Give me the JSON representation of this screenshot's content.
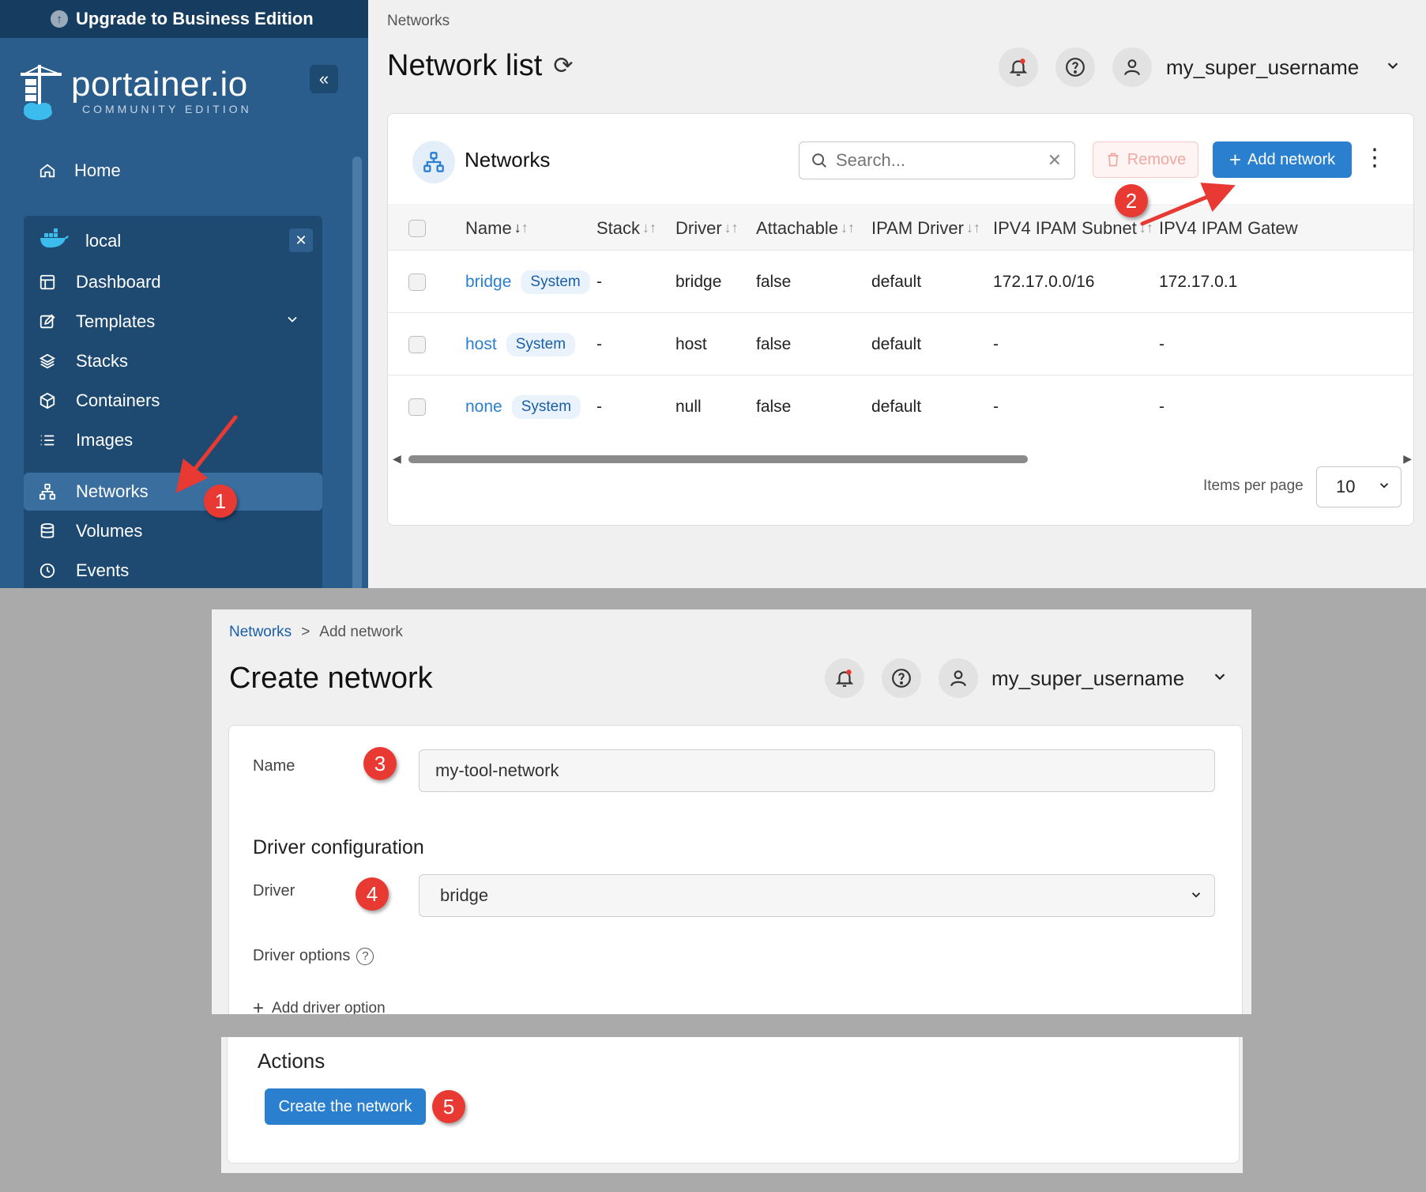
{
  "sidebar": {
    "upgrade_label": "Upgrade to Business Edition",
    "logo_text": "portainer.io",
    "logo_subtitle": "COMMUNITY EDITION",
    "home_label": "Home",
    "environment": {
      "name": "local",
      "items": [
        {
          "label": "Dashboard",
          "icon": "dashboard-icon"
        },
        {
          "label": "Templates",
          "icon": "templates-icon"
        },
        {
          "label": "Stacks",
          "icon": "stacks-icon"
        },
        {
          "label": "Containers",
          "icon": "containers-icon"
        },
        {
          "label": "Images",
          "icon": "images-icon"
        },
        {
          "label": "Networks",
          "icon": "networks-icon",
          "active": true
        },
        {
          "label": "Volumes",
          "icon": "volumes-icon"
        },
        {
          "label": "Events",
          "icon": "events-icon"
        }
      ]
    }
  },
  "network_list": {
    "breadcrumb": "Networks",
    "title": "Network list",
    "user_name": "my_super_username",
    "card_title": "Networks",
    "search_placeholder": "Search...",
    "remove_label": "Remove",
    "add_label": "Add network",
    "columns": [
      "Name",
      "Stack",
      "Driver",
      "Attachable",
      "IPAM Driver",
      "IPV4 IPAM Subnet",
      "IPV4 IPAM Gatew"
    ],
    "rows": [
      {
        "name": "bridge",
        "badge": "System",
        "stack": "-",
        "driver": "bridge",
        "attachable": "false",
        "ipam_driver": "default",
        "subnet": "172.17.0.0/16",
        "gateway": "172.17.0.1"
      },
      {
        "name": "host",
        "badge": "System",
        "stack": "-",
        "driver": "host",
        "attachable": "false",
        "ipam_driver": "default",
        "subnet": "-",
        "gateway": "-"
      },
      {
        "name": "none",
        "badge": "System",
        "stack": "-",
        "driver": "null",
        "attachable": "false",
        "ipam_driver": "default",
        "subnet": "-",
        "gateway": "-"
      }
    ],
    "items_per_page_label": "Items per page",
    "items_per_page_value": "10"
  },
  "create_network": {
    "breadcrumb_link": "Networks",
    "breadcrumb_sep": ">",
    "breadcrumb_current": "Add network",
    "title": "Create network",
    "user_name": "my_super_username",
    "name_label": "Name",
    "name_value": "my-tool-network",
    "driver_section": "Driver configuration",
    "driver_label": "Driver",
    "driver_value": "bridge",
    "driver_options_label": "Driver options",
    "add_driver_option": "Add driver option",
    "actions_title": "Actions",
    "create_button": "Create the network"
  },
  "annotations": [
    "1",
    "2",
    "3",
    "4",
    "5"
  ],
  "colors": {
    "sidebar_bg": "#2a5c8c",
    "sidebar_dark": "#163d5f",
    "primary": "#2a7fce",
    "marker": "#e83a33"
  }
}
